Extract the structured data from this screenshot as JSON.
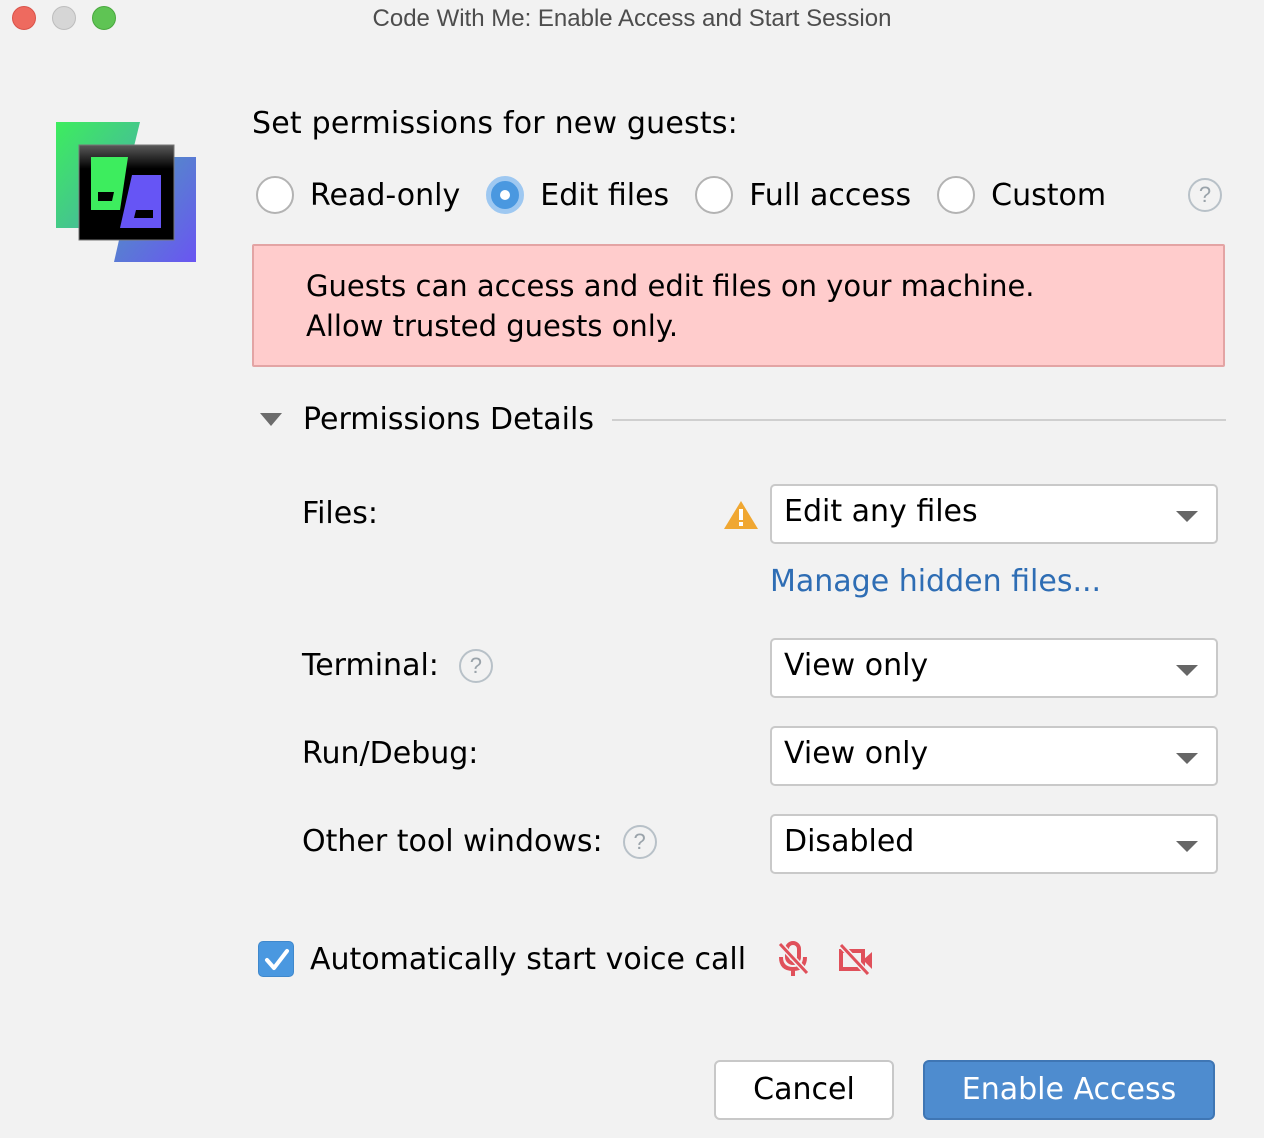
{
  "window": {
    "title": "Code With Me: Enable Access and Start Session",
    "controls": [
      "close",
      "minimize",
      "maximize"
    ]
  },
  "logo": {
    "name": "code-with-me-logo"
  },
  "permissions": {
    "heading": "Set permissions for new guests:",
    "options": [
      {
        "label": "Read-only",
        "selected": false
      },
      {
        "label": "Edit files",
        "selected": true
      },
      {
        "label": "Full access",
        "selected": false
      },
      {
        "label": "Custom",
        "selected": false
      }
    ],
    "help_icon": "question-mark-icon"
  },
  "warning": {
    "line1": "Guests can access and edit files on your machine.",
    "line2": "Allow trusted guests only.",
    "background": "#ffcccc"
  },
  "details": {
    "title": "Permissions Details",
    "expanded": true,
    "rows": [
      {
        "label": "Files:",
        "value": "Edit any files",
        "warning_icon": true,
        "help": false
      },
      {
        "label": "Terminal:",
        "value": "View only",
        "warning_icon": false,
        "help": true
      },
      {
        "label": "Run/Debug:",
        "value": "View only",
        "warning_icon": false,
        "help": false
      },
      {
        "label": "Other tool windows:",
        "value": "Disabled",
        "warning_icon": false,
        "help": true
      }
    ],
    "manage_link": "Manage hidden files..."
  },
  "voice_call": {
    "label": "Automatically start voice call",
    "checked": true,
    "icons": [
      "microphone-off-icon",
      "camera-off-icon"
    ]
  },
  "buttons": {
    "cancel": "Cancel",
    "primary": "Enable Access"
  },
  "colors": {
    "accent": "#4a98e0",
    "primary_button": "#4e8ccf",
    "link": "#2e6db4",
    "warning_icon": "#f0a732",
    "media_off": "#e0505a"
  }
}
